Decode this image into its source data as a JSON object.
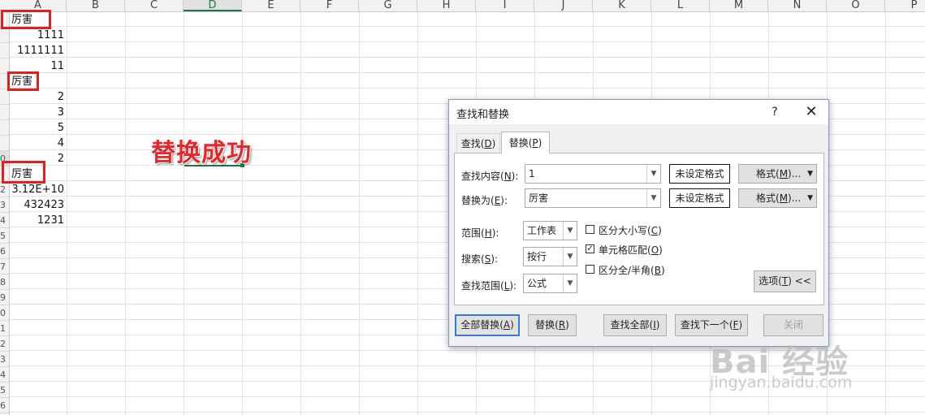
{
  "sheet": {
    "columns": [
      "A",
      "B",
      "C",
      "D",
      "E",
      "F",
      "G",
      "H",
      "I",
      "J",
      "K",
      "L",
      "M",
      "N",
      "O",
      "P"
    ],
    "active_column": "D",
    "row_numbers": [
      "",
      "",
      "",
      "",
      "",
      "",
      "",
      "",
      "",
      "0",
      "",
      "2",
      "3",
      "4",
      "5",
      "6",
      "7",
      "8",
      "9",
      "0",
      "1",
      "2",
      "3",
      "4",
      "5",
      "6"
    ],
    "cells": {
      "a1": "厉害",
      "a2": "1111",
      "a3": "1111111",
      "a4": "11",
      "a5": "厉害",
      "a6": "2",
      "a7": "3",
      "a8": "5",
      "a9": "4",
      "a10": "2",
      "a11": "厉害",
      "a12": "3.12E+10",
      "a13": "432423",
      "a14": "1231"
    },
    "annotation": "替换成功",
    "accent_color": "#217346",
    "highlight_color": "#e02020"
  },
  "dialog": {
    "title": "查找和替换",
    "help": "?",
    "close": "✕",
    "tabs": {
      "find": "查找(D)",
      "replace": "替换(P)"
    },
    "find_label": "查找内容(N):",
    "find_value": "1",
    "replace_label": "替换为(E):",
    "replace_value": "厉害",
    "format_preview": "未设定格式",
    "format_button": "格式(M)...",
    "scope_label": "范围(H):",
    "scope_value": "工作表",
    "search_label": "搜索(S):",
    "search_value": "按行",
    "lookin_label": "查找范围(L):",
    "lookin_value": "公式",
    "checkboxes": [
      {
        "label": "区分大小写(C)",
        "checked": false
      },
      {
        "label": "单元格匹配(O)",
        "checked": true
      },
      {
        "label": "区分全/半角(B)",
        "checked": false
      }
    ],
    "options_button": "选项(T) <<",
    "buttons": {
      "replace_all": "全部替换(A)",
      "replace": "替换(R)",
      "find_all": "查找全部(I)",
      "find_next": "查找下一个(F)",
      "close": "关闭"
    }
  },
  "watermark": {
    "logo": "Bai 经验",
    "url": "jingyan.baidu.com"
  }
}
